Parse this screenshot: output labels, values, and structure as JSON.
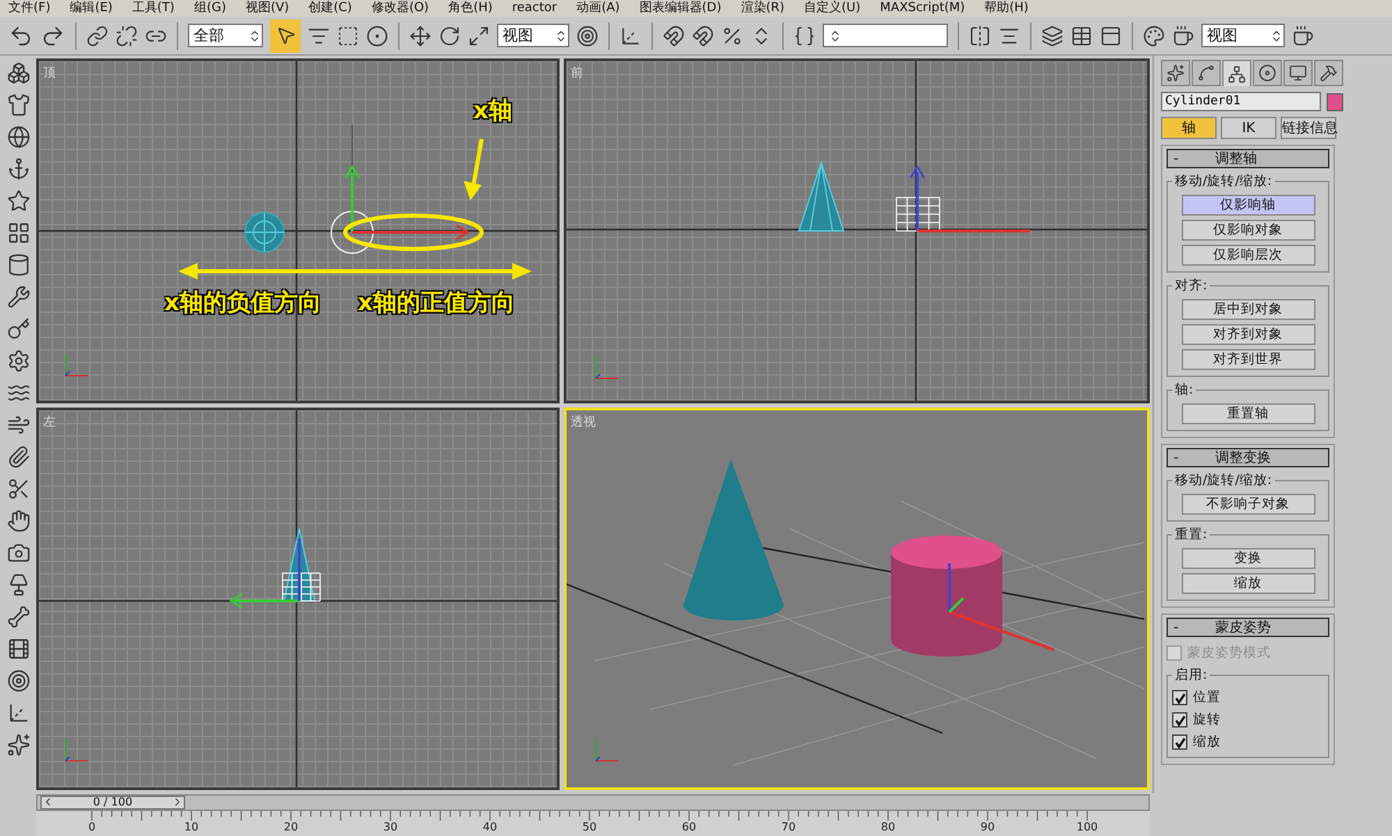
{
  "menu": [
    "文件(F)",
    "编辑(E)",
    "工具(T)",
    "组(G)",
    "视图(V)",
    "创建(C)",
    "修改器(O)",
    "角色(H)",
    "reactor",
    "动画(A)",
    "图表编辑器(D)",
    "渲染(R)",
    "自定义(U)",
    "MAXScript(M)",
    "帮助(H)"
  ],
  "toolbar": {
    "selection_filter": "全部",
    "select_button": {
      "selected": true
    },
    "coordinate_system": "视图",
    "render_view": "视图"
  },
  "viewports": [
    {
      "label": "顶",
      "kind": "top",
      "selected": false
    },
    {
      "label": "前",
      "kind": "front",
      "selected": false
    },
    {
      "label": "左",
      "kind": "left",
      "selected": false
    },
    {
      "label": "透视",
      "kind": "perspective",
      "selected": true
    }
  ],
  "annotations": {
    "axis_label": "x轴",
    "negative_direction": "x轴的负值方向",
    "positive_direction": "x轴的正值方向"
  },
  "command_panel": {
    "tabs": [
      {
        "selected": false
      },
      {
        "selected": false
      },
      {
        "selected": true
      },
      {
        "selected": false
      },
      {
        "selected": false
      },
      {
        "selected": false
      }
    ],
    "object_name": "Cylinder01",
    "mode_buttons": [
      {
        "label": "轴",
        "selected": true
      },
      {
        "label": "IK",
        "selected": false
      },
      {
        "label": "链接信息",
        "selected": false
      }
    ],
    "rollouts": [
      {
        "toggle": "-",
        "title": "调整轴",
        "groups": [
          {
            "title": "移动/旋转/缩放:",
            "items": [
              {
                "kind": "button",
                "label": "仅影响轴",
                "selected": true
              },
              {
                "kind": "button",
                "label": "仅影响对象",
                "selected": false
              },
              {
                "kind": "button",
                "label": "仅影响层次",
                "selected": false
              }
            ]
          },
          {
            "title": "对齐:",
            "items": [
              {
                "kind": "button",
                "label": "居中到对象",
                "selected": false
              },
              {
                "kind": "button",
                "label": "对齐到对象",
                "selected": false
              },
              {
                "kind": "button",
                "label": "对齐到世界",
                "selected": false
              }
            ]
          },
          {
            "title": "轴:",
            "items": [
              {
                "kind": "button",
                "label": "重置轴",
                "selected": false
              }
            ]
          }
        ]
      },
      {
        "toggle": "-",
        "title": "调整变换",
        "groups": [
          {
            "title": "移动/旋转/缩放:",
            "items": [
              {
                "kind": "button",
                "label": "不影响子对象",
                "selected": false
              }
            ]
          },
          {
            "title": "重置:",
            "items": [
              {
                "kind": "button",
                "label": "变换",
                "selected": false
              },
              {
                "kind": "button",
                "label": "缩放",
                "selected": false
              }
            ]
          }
        ]
      },
      {
        "toggle": "-",
        "title": "蒙皮姿势",
        "items": [
          {
            "kind": "checkbox",
            "label": "蒙皮姿势模式",
            "checked": false,
            "disabled": true
          }
        ],
        "groups": [
          {
            "title": "启用:",
            "items": [
              {
                "kind": "checkbox",
                "label": "位置",
                "checked": true,
                "disabled": false
              },
              {
                "kind": "checkbox",
                "label": "旋转",
                "checked": true,
                "disabled": false
              },
              {
                "kind": "checkbox",
                "label": "缩放",
                "checked": true,
                "disabled": false
              }
            ]
          }
        ]
      }
    ]
  },
  "time_slider": {
    "position": "0 / 100",
    "level": 0
  },
  "track_bar": {
    "ticks": [
      "0",
      "10",
      "20",
      "30",
      "40",
      "50",
      "60",
      "70",
      "80",
      "90",
      "100"
    ]
  }
}
